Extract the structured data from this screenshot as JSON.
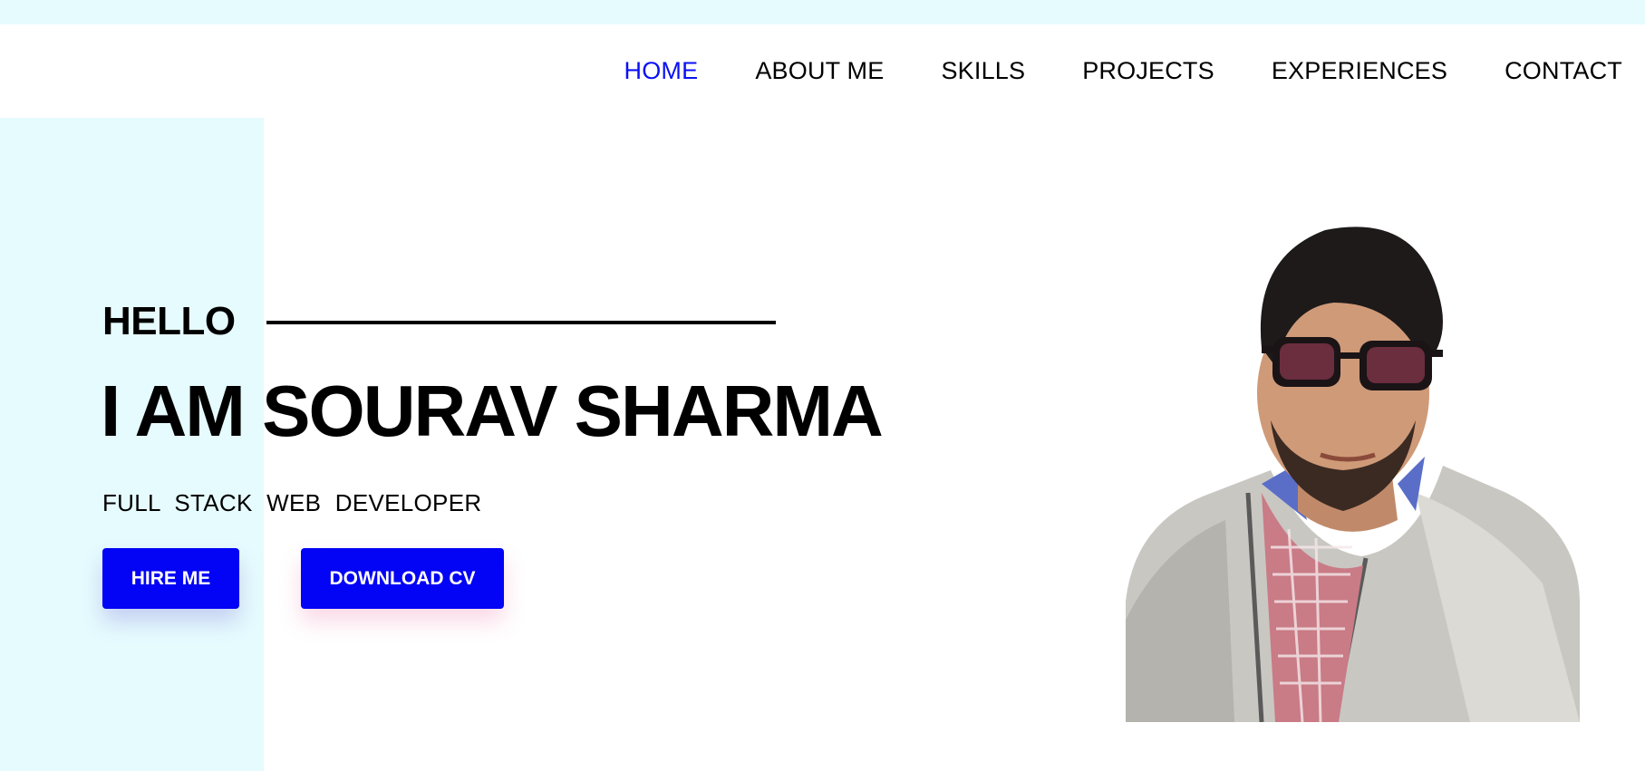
{
  "nav": {
    "items": [
      {
        "label": "HOME",
        "active": true
      },
      {
        "label": "ABOUT ME",
        "active": false
      },
      {
        "label": "SKILLS",
        "active": false
      },
      {
        "label": "PROJECTS",
        "active": false
      },
      {
        "label": "EXPERIENCES",
        "active": false
      },
      {
        "label": "CONTACT",
        "active": false
      }
    ]
  },
  "hero": {
    "greeting": "HELLO",
    "name": "I AM SOURAV SHARMA",
    "role": "FULL  STACK  WEB  DEVELOPER",
    "hire_button": "HIRE ME",
    "cv_button": "DOWNLOAD CV"
  },
  "colors": {
    "accent": "#0303f5",
    "active_nav": "#0a10f5",
    "panel": "#e6fbfe"
  },
  "profile_image": {
    "icon": "profile-photo"
  }
}
